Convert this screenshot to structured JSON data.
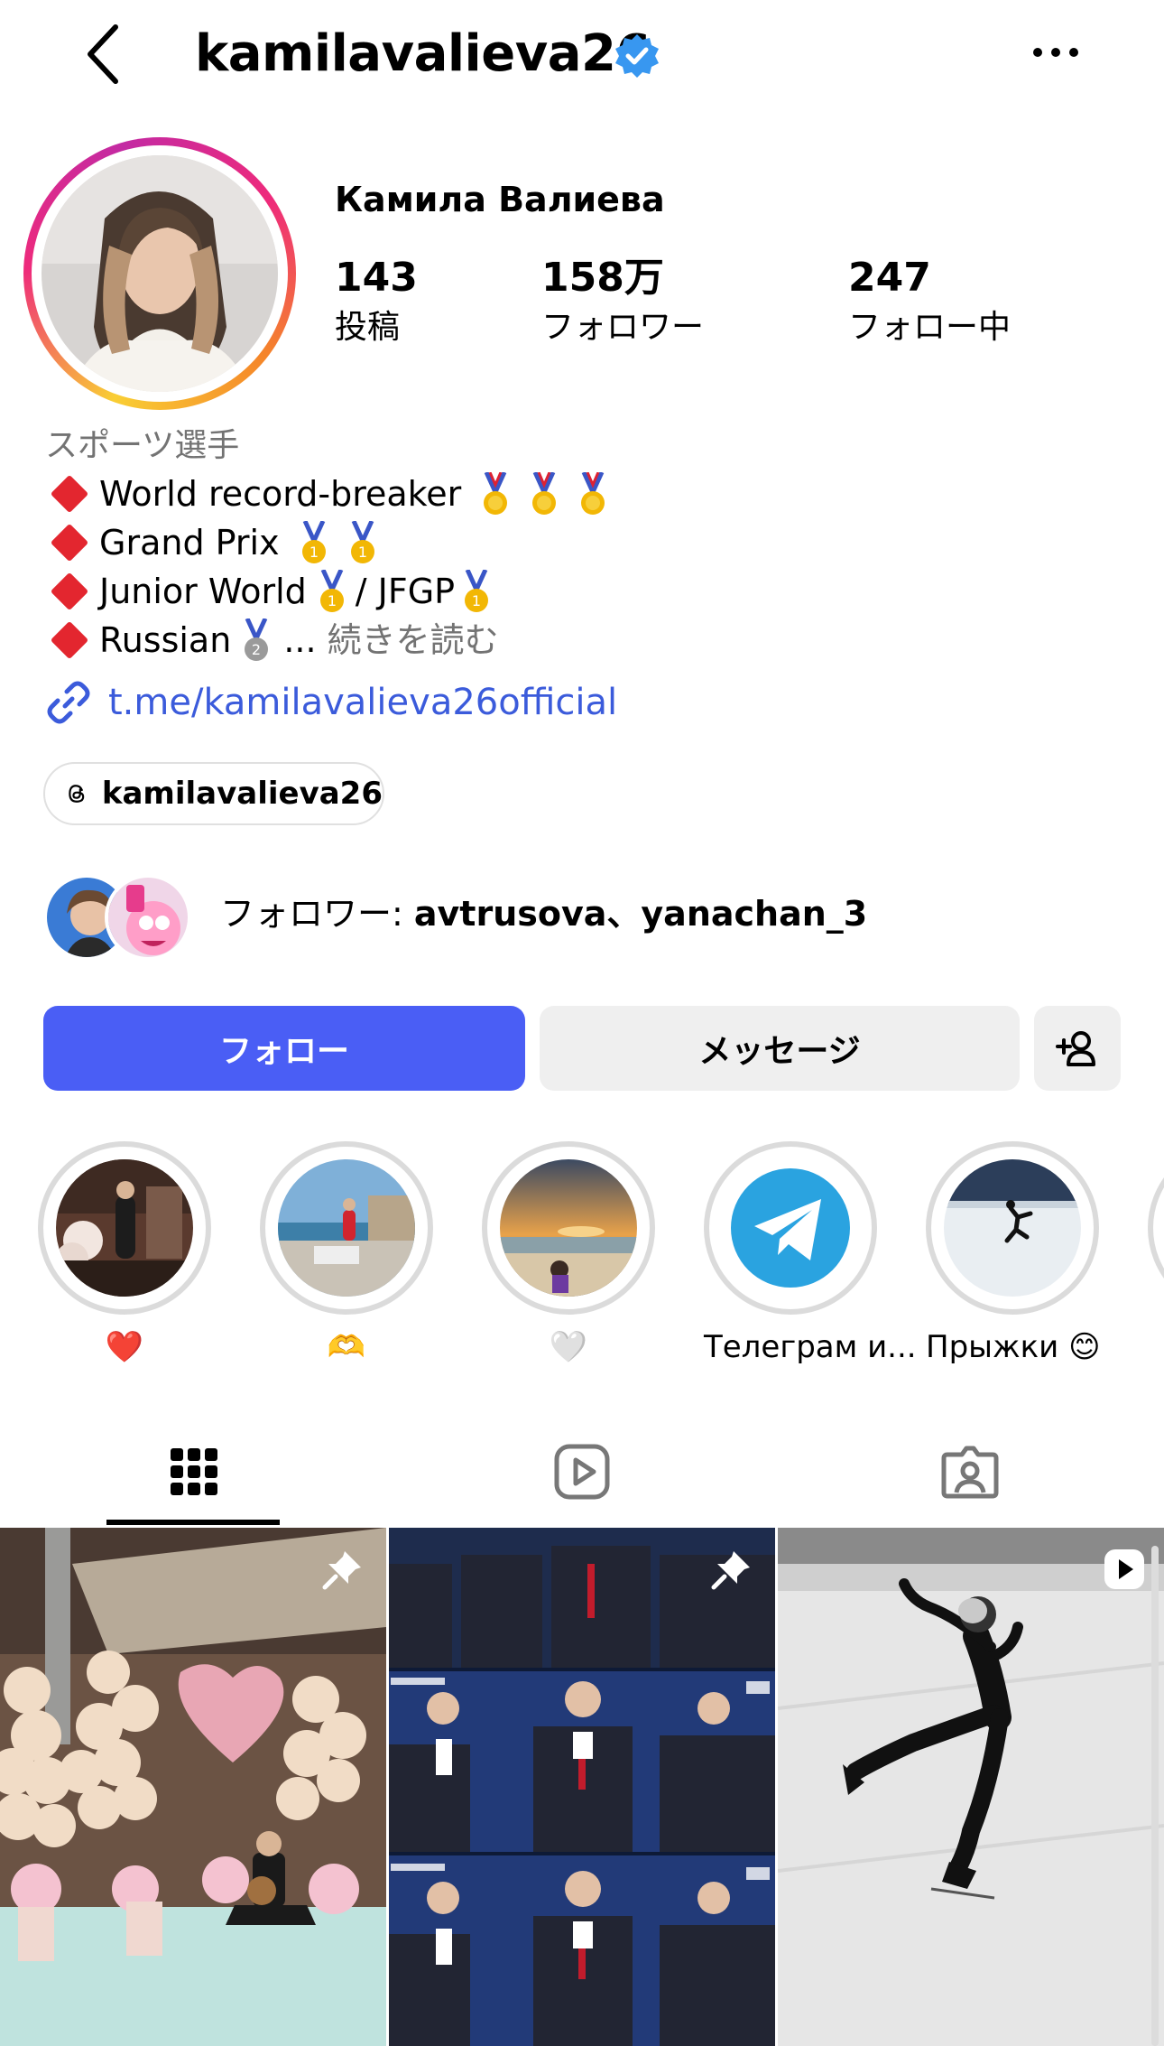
{
  "header": {
    "username": "kamilavalieva26",
    "back_icon": "chevron-left-icon",
    "verified_icon": "verified-badge-icon",
    "more_icon": "more-horizontal-icon"
  },
  "profile": {
    "display_name": "Камила Валиева",
    "stats": [
      {
        "value": "143",
        "label": "投稿"
      },
      {
        "value": "158万",
        "label": "フォロワー"
      },
      {
        "value": "247",
        "label": "フォロー中"
      }
    ],
    "category": "スポーツ選手",
    "bio": [
      "World record-breaker",
      "Grand Prix",
      "Junior World",
      "/ JFGP",
      "Russian",
      "..."
    ],
    "more_text": "続きを読む",
    "link": "t.me/kamilavalieva26official",
    "threads_handle": "kamilavalieva26"
  },
  "followed_by": {
    "prefix": "フォロワー: ",
    "names": "avtrusova、yanachan_3"
  },
  "actions": {
    "follow": "フォロー",
    "message": "メッセージ",
    "add_user_icon": "add-user-icon"
  },
  "highlights": [
    {
      "label": "❤️"
    },
    {
      "label": "🫶"
    },
    {
      "label": "🤍"
    },
    {
      "label": "Телеграм и..."
    },
    {
      "label": "Прыжки 😊"
    }
  ],
  "tabs": [
    {
      "icon": "grid-icon",
      "active": true
    },
    {
      "icon": "reels-icon",
      "active": false
    },
    {
      "icon": "tagged-icon",
      "active": false
    }
  ],
  "colors": {
    "accent": "#4a5ef5",
    "link": "#3b5bdb",
    "diamond": "#e3262f",
    "verified": "#3897f0"
  }
}
